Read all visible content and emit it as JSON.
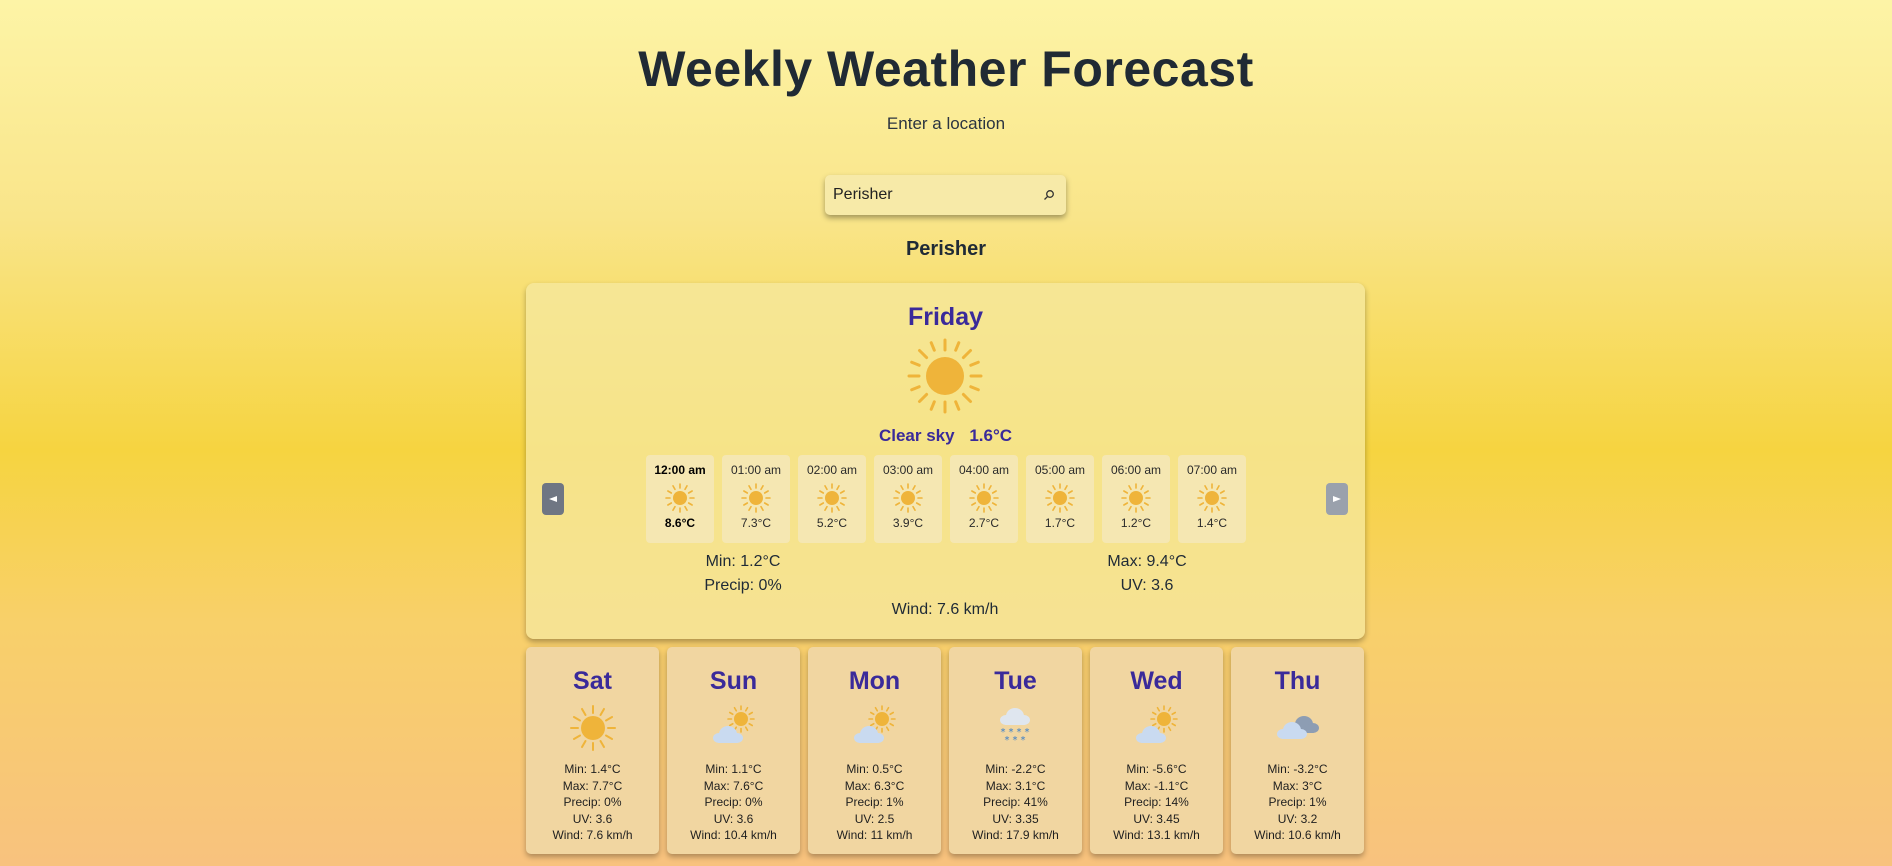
{
  "header": {
    "title": "Weekly Weather Forecast",
    "subtitle": "Enter a location"
  },
  "search": {
    "value": "Perisher",
    "button_icon": "search-icon"
  },
  "location": "Perisher",
  "today": {
    "day": "Friday",
    "icon": "sun-icon",
    "condition": "Clear sky",
    "temperature": "1.6°C",
    "hourly": [
      {
        "time": "12:00 am",
        "temp": "8.6°C",
        "icon": "sun-icon"
      },
      {
        "time": "01:00 am",
        "temp": "7.3°C",
        "icon": "sun-icon"
      },
      {
        "time": "02:00 am",
        "temp": "5.2°C",
        "icon": "sun-icon"
      },
      {
        "time": "03:00 am",
        "temp": "3.9°C",
        "icon": "sun-icon"
      },
      {
        "time": "04:00 am",
        "temp": "2.7°C",
        "icon": "sun-icon"
      },
      {
        "time": "05:00 am",
        "temp": "1.7°C",
        "icon": "sun-icon"
      },
      {
        "time": "06:00 am",
        "temp": "1.2°C",
        "icon": "sun-icon"
      },
      {
        "time": "07:00 am",
        "temp": "1.4°C",
        "icon": "sun-icon"
      }
    ],
    "min": "Min: 1.2°C",
    "max": "Max: 9.4°C",
    "precip": "Precip: 0%",
    "uv": "UV: 3.6",
    "wind": "Wind: 7.6 km/h"
  },
  "forecast": [
    {
      "day": "Sat",
      "icon": "sun-icon",
      "min": "Min: 1.4°C",
      "max": "Max: 7.7°C",
      "precip": "Precip: 0%",
      "uv": "UV: 3.6",
      "wind": "Wind: 7.6 km/h"
    },
    {
      "day": "Sun",
      "icon": "partly-cloudy-icon",
      "min": "Min: 1.1°C",
      "max": "Max: 7.6°C",
      "precip": "Precip: 0%",
      "uv": "UV: 3.6",
      "wind": "Wind: 10.4 km/h"
    },
    {
      "day": "Mon",
      "icon": "partly-cloudy-icon",
      "min": "Min: 0.5°C",
      "max": "Max: 6.3°C",
      "precip": "Precip: 1%",
      "uv": "UV: 2.5",
      "wind": "Wind: 11 km/h"
    },
    {
      "day": "Tue",
      "icon": "snow-icon",
      "min": "Min: -2.2°C",
      "max": "Max: 3.1°C",
      "precip": "Precip: 41%",
      "uv": "UV: 3.35",
      "wind": "Wind: 17.9 km/h"
    },
    {
      "day": "Wed",
      "icon": "partly-cloudy-icon",
      "min": "Min: -5.6°C",
      "max": "Max: -1.1°C",
      "precip": "Precip: 14%",
      "uv": "UV: 3.45",
      "wind": "Wind: 13.1 km/h"
    },
    {
      "day": "Thu",
      "icon": "cloudy-icon",
      "min": "Min: -3.2°C",
      "max": "Max: 3°C",
      "precip": "Precip: 1%",
      "uv": "UV: 3.2",
      "wind": "Wind: 10.6 km/h"
    }
  ],
  "colors": {
    "accent": "#3a2a9a",
    "sun": "#efb43a",
    "cloud": "#c9daf0"
  }
}
